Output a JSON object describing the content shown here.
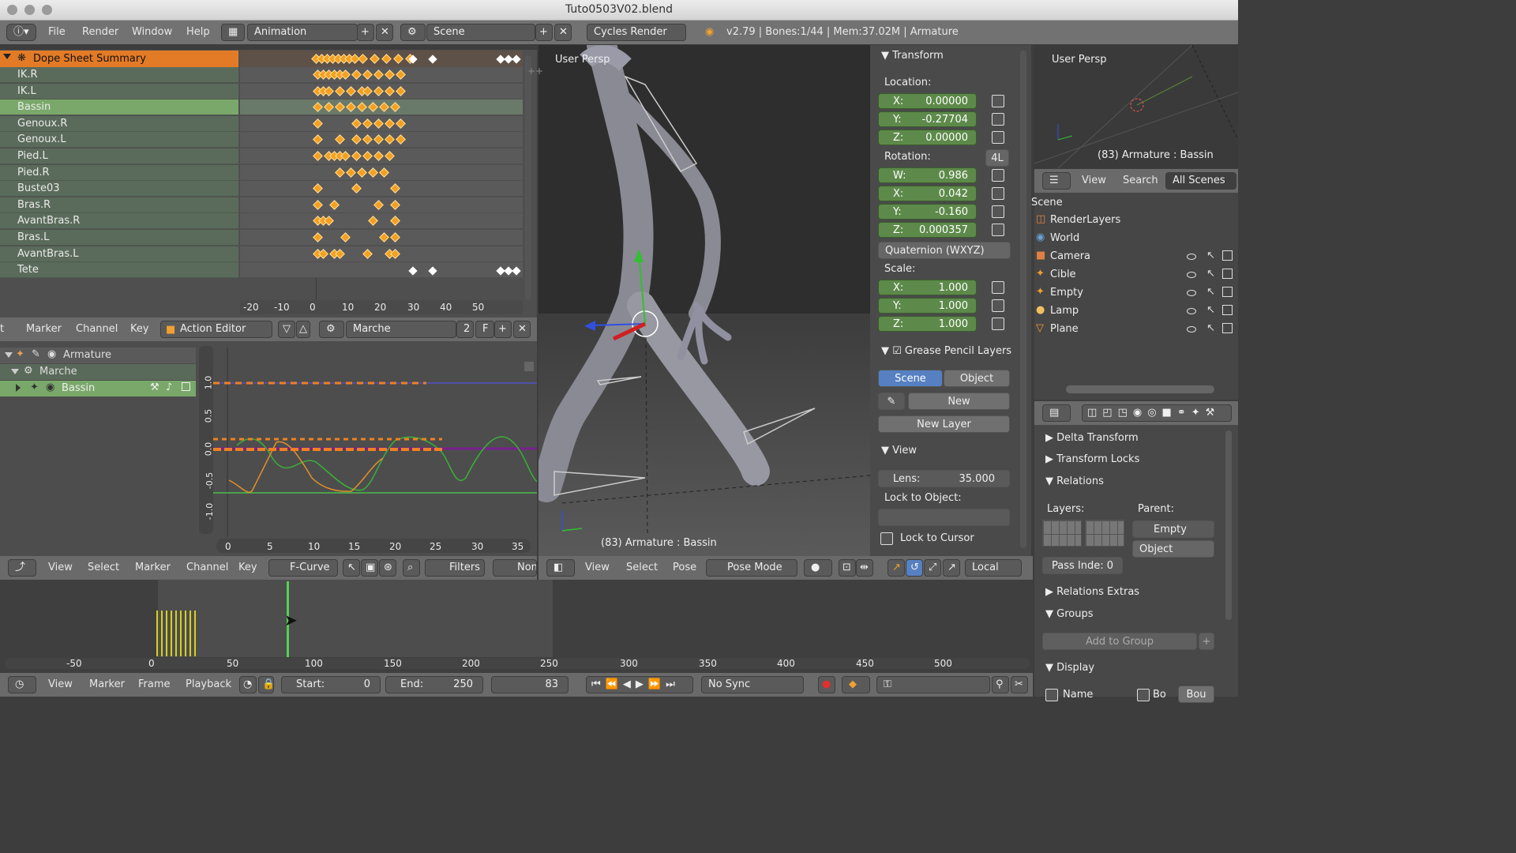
{
  "window": {
    "title": "Tuto0503V02.blend"
  },
  "topbar": {
    "menus": [
      "File",
      "Render",
      "Window",
      "Help"
    ],
    "layout": "Animation",
    "scene": "Scene",
    "engine": "Cycles Render",
    "stats": "v2.79 | Bones:1/44 | Mem:37.02M | Armature"
  },
  "dopesheet": {
    "summary": "Dope Sheet Summary",
    "channels": [
      "IK.R",
      "IK.L",
      "Bassin",
      "Genoux.R",
      "Genoux.L",
      "Pied.L",
      "Pied.R",
      "Buste03",
      "Bras.R",
      "AvantBras.R",
      "Bras.L",
      "AvantBras.L",
      "Tete"
    ],
    "selected_channel": "Bassin",
    "ticks": [
      "-20",
      "-10",
      "0",
      "10",
      "20",
      "30",
      "40",
      "50"
    ],
    "header": {
      "menus": [
        "Marker",
        "Channel",
        "Key"
      ],
      "cut_label": "t",
      "mode": "Action Editor",
      "action": "Marche",
      "users": "2",
      "fake": "F"
    }
  },
  "graph": {
    "channels": {
      "armature": "Armature",
      "action": "Marche",
      "bone": "Bassin"
    },
    "y_ticks": [
      "1.0",
      "0.5",
      "0.0",
      "-0.5",
      "-1.0"
    ],
    "x_ticks": [
      "0",
      "5",
      "10",
      "15",
      "20",
      "25",
      "30",
      "35"
    ],
    "header": {
      "menus": [
        "View",
        "Select",
        "Marker",
        "Channel",
        "Key"
      ],
      "mode": "F-Curve",
      "filters": "Filters",
      "normalize": "Non"
    }
  },
  "viewport": {
    "label": "User Persp",
    "status": "(83) Armature : Bassin",
    "header": {
      "menus": [
        "View",
        "Select",
        "Pose"
      ],
      "mode": "Pose Mode",
      "orientation": "Local"
    }
  },
  "transform": {
    "title": "Transform",
    "location_label": "Location:",
    "location": [
      {
        "axis": "X:",
        "value": "0.00000"
      },
      {
        "axis": "Y:",
        "value": "-0.27704"
      },
      {
        "axis": "Z:",
        "value": "0.00000"
      }
    ],
    "rotation_label": "Rotation:",
    "rotation_lock": "4L",
    "rotation": [
      {
        "axis": "W:",
        "value": "0.986"
      },
      {
        "axis": "X:",
        "value": "0.042"
      },
      {
        "axis": "Y:",
        "value": "-0.160"
      },
      {
        "axis": "Z:",
        "value": "0.000357"
      }
    ],
    "rotation_mode": "Quaternion (WXYZ)",
    "scale_label": "Scale:",
    "scale": [
      {
        "axis": "X:",
        "value": "1.000"
      },
      {
        "axis": "Y:",
        "value": "1.000"
      },
      {
        "axis": "Z:",
        "value": "1.000"
      }
    ],
    "grease_title": "Grease Pencil Layers",
    "grease_tabs": [
      "Scene",
      "Object"
    ],
    "new_label": "New",
    "new_layer": "New Layer",
    "view_title": "View",
    "lens_label": "Lens:",
    "lens_value": "35.000",
    "lock_object": "Lock to Object:",
    "lock_cursor": "Lock to Cursor"
  },
  "mini_view": {
    "label": "User Persp",
    "status": "(83) Armature : Bassin"
  },
  "outliner": {
    "menus": [
      "View",
      "Search"
    ],
    "filter": "All Scenes",
    "scene_label": "Scene",
    "items": [
      "RenderLayers",
      "World",
      "Camera",
      "Cible",
      "Empty",
      "Lamp",
      "Plane"
    ]
  },
  "properties": {
    "sections": [
      "Delta Transform",
      "Transform Locks",
      "Relations"
    ],
    "layers_label": "Layers:",
    "parent_label": "Parent:",
    "parent": "Empty",
    "parent_type": "Object",
    "pass_index": "Pass Inde: 0",
    "relations_extras": "Relations Extras",
    "groups": "Groups",
    "add_group": "Add to Group",
    "display": "Display",
    "name_cut": "Name",
    "bo_cut": "Bo",
    "bo2_cut": "Bou"
  },
  "timeline": {
    "ticks": [
      "-50",
      "0",
      "50",
      "100",
      "150",
      "200",
      "250",
      "300",
      "350",
      "400",
      "450",
      "500"
    ],
    "header": {
      "menus": [
        "View",
        "Marker",
        "Frame",
        "Playback"
      ],
      "start_label": "Start:",
      "start": "0",
      "end_label": "End:",
      "end": "250",
      "current": "83",
      "sync": "No Sync"
    }
  }
}
